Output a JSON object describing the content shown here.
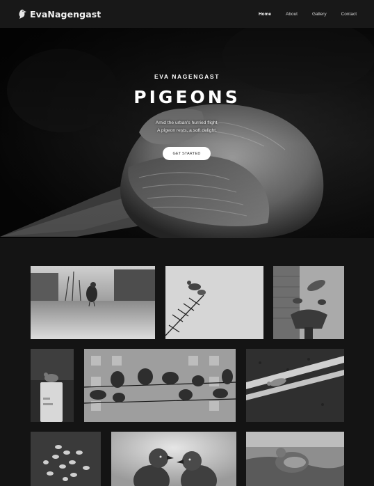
{
  "nav": {
    "brand": "EvaNagengast",
    "items": [
      {
        "label": "Home",
        "active": true
      },
      {
        "label": "About",
        "active": false
      },
      {
        "label": "Gallery",
        "active": false
      },
      {
        "label": "Contact",
        "active": false
      }
    ]
  },
  "hero": {
    "eyebrow": "EVA NAGENGAST",
    "title": "PIGEONS",
    "tagline_line1": "Amid the urban's hurried flight,",
    "tagline_line2": "A pigeon rests, a soft delight.",
    "cta_label": "GET STARTED"
  },
  "gallery": {
    "tiles": [
      {
        "subject": "pigeon on city street"
      },
      {
        "subject": "pigeons on antenna"
      },
      {
        "subject": "pigeons on fountain"
      },
      {
        "subject": "pigeon on post"
      },
      {
        "subject": "pigeons on wires"
      },
      {
        "subject": "pigeon on road lines"
      },
      {
        "subject": "flock from above"
      },
      {
        "subject": "two pigeons face to face"
      },
      {
        "subject": "pigeon by puddle"
      }
    ]
  },
  "theme": {
    "background": "#141414",
    "nav_background": "#181818",
    "accent": "#ffffff"
  }
}
